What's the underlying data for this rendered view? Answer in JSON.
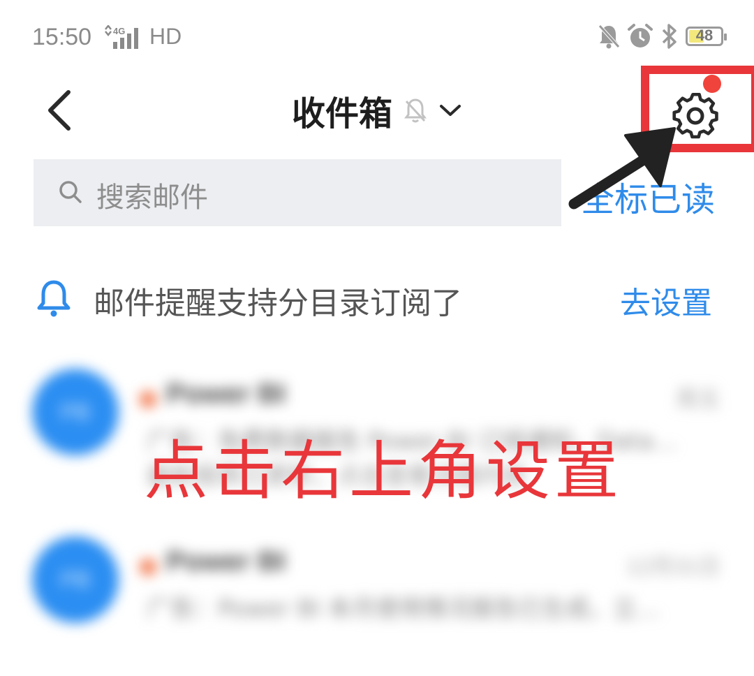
{
  "status_bar": {
    "time": "15:50",
    "network": "4G",
    "hd": "HD",
    "battery": "48",
    "battery_level": 0.48,
    "icons": [
      "mute-icon",
      "alarm-icon",
      "bluetooth-icon",
      "battery-icon"
    ]
  },
  "header": {
    "title": "收件箱",
    "back_icon": "chevron-left-icon",
    "settings_icon": "gear-icon"
  },
  "search": {
    "placeholder": "搜索邮件",
    "mark_all_read": "全标已读"
  },
  "notice": {
    "text": "邮件提醒支持分目录订阅了",
    "action": "去设置"
  },
  "mail_list": [
    {
      "avatar": "PB",
      "sender": "Power BI",
      "time": "周五",
      "preview": "广告：免费数据报告 Power BI 订阅通知，Data…",
      "preview2": "最新报表已更新，点击查看详细内容"
    },
    {
      "avatar": "PB",
      "sender": "Power BI",
      "time": "12月31日",
      "preview": "广告：Power BI 本月使用情况报告已生成，立…",
      "preview2": ""
    }
  ],
  "annotation": {
    "text": "点击右上角设置",
    "color": "#e8363a"
  },
  "colors": {
    "accent_blue": "#2f8bea",
    "badge_red": "#f0433b",
    "search_bg": "#eceef1"
  }
}
